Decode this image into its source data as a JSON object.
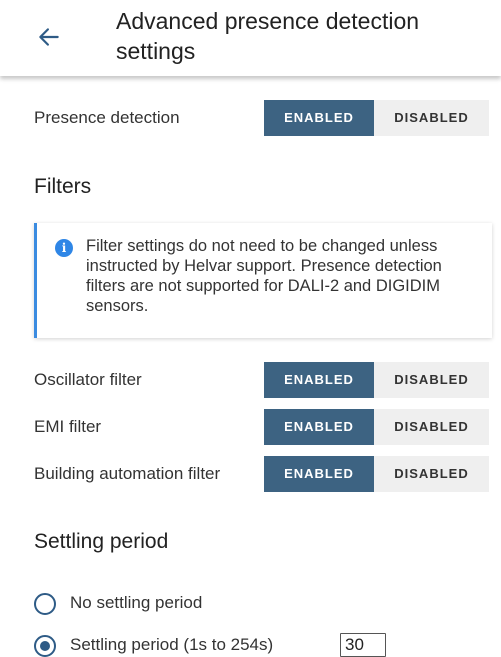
{
  "header": {
    "title": "Advanced presence detection settings",
    "back_icon": "arrow-left-icon"
  },
  "presence_detection": {
    "label": "Presence detection",
    "enabled_label": "ENABLED",
    "disabled_label": "DISABLED",
    "selected": "enabled"
  },
  "filters": {
    "heading": "Filters",
    "info_icon": "info-icon",
    "info_text": "Filter settings do not need to be changed unless instructed by Helvar support. Presence detection filters are not supported for DALI-2 and DIGIDIM sensors.",
    "items": [
      {
        "label": "Oscillator filter",
        "enabled_label": "ENABLED",
        "disabled_label": "DISABLED",
        "selected": "enabled"
      },
      {
        "label": "EMI filter",
        "enabled_label": "ENABLED",
        "disabled_label": "DISABLED",
        "selected": "enabled"
      },
      {
        "label": "Building automation filter",
        "enabled_label": "ENABLED",
        "disabled_label": "DISABLED",
        "selected": "enabled"
      }
    ]
  },
  "settling_period": {
    "heading": "Settling period",
    "options": [
      {
        "label": "No settling period",
        "selected": false
      },
      {
        "label": "Settling period (1s to 254s)",
        "selected": true
      }
    ],
    "value": "30"
  },
  "colors": {
    "accent": "#3d6382",
    "info_blue": "#2f86e6",
    "inactive_segment": "#efefef"
  }
}
